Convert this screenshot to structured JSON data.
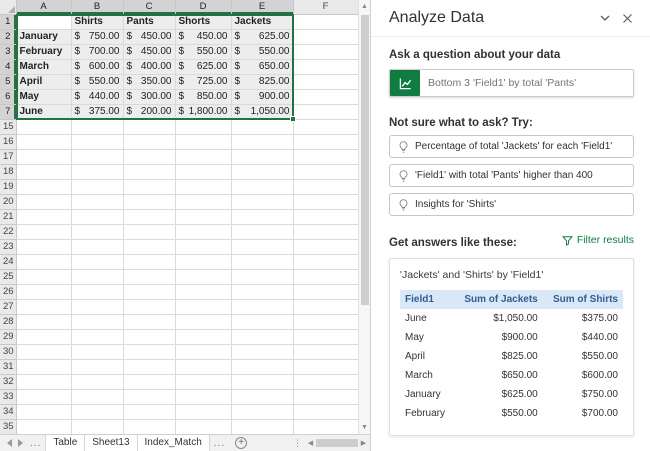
{
  "colors": {
    "excel_green": "#217346",
    "query_icon_green": "#107C41",
    "filter_link_green": "#0E7C41",
    "header_bg": "#E9E9E9",
    "header_selected_bg": "#D3D3D3",
    "selection_fill": "#EDEDED",
    "table_header_bg": "#D9E7F6",
    "table_header_text": "#2E5E94"
  },
  "spreadsheet": {
    "currency": "$",
    "columns": [
      "A",
      "B",
      "C",
      "D",
      "E",
      "F"
    ],
    "selected_columns": [
      "A",
      "B",
      "C",
      "D",
      "E"
    ],
    "selected_rows": [
      1,
      2,
      3,
      4,
      5,
      6,
      7
    ],
    "active_cell": "A1",
    "rows": [
      {
        "num": 1,
        "cells": [
          "",
          "Shirts",
          "Pants",
          "Shorts",
          "Jackets"
        ],
        "bold": true
      },
      {
        "num": 2,
        "cells": [
          "January",
          "750.00",
          "450.00",
          "450.00",
          "625.00"
        ],
        "currency": true
      },
      {
        "num": 3,
        "cells": [
          "February",
          "700.00",
          "450.00",
          "550.00",
          "550.00"
        ],
        "currency": true
      },
      {
        "num": 4,
        "cells": [
          "March",
          "600.00",
          "400.00",
          "625.00",
          "650.00"
        ],
        "currency": true
      },
      {
        "num": 5,
        "cells": [
          "April",
          "550.00",
          "350.00",
          "725.00",
          "825.00"
        ],
        "currency": true
      },
      {
        "num": 6,
        "cells": [
          "May",
          "440.00",
          "300.00",
          "850.00",
          "900.00"
        ],
        "currency": true
      },
      {
        "num": 7,
        "cells": [
          "June",
          "375.00",
          "200.00",
          "1,800.00",
          "1,050.00"
        ],
        "currency": true
      }
    ],
    "empty_row_numbers": [
      15,
      16,
      17,
      18,
      19,
      20,
      21,
      22,
      23,
      24,
      25,
      26,
      27,
      28,
      29,
      30,
      31,
      32,
      33,
      34,
      35
    ]
  },
  "sheet_tabs": {
    "tabs": [
      "Table",
      "Sheet13",
      "Index_Match"
    ],
    "overflow_indicator": "...",
    "new_sheet_label": "+"
  },
  "pane": {
    "title": "Analyze Data",
    "ask_heading": "Ask a question about your data",
    "query_text": "Bottom 3 'Field1' by total 'Pants'",
    "try_heading": "Not sure what to ask? Try:",
    "suggestions": [
      "Percentage of total 'Jackets' for each 'Field1'",
      "'Field1' with total 'Pants' higher than 400",
      "Insights for 'Shirts'"
    ],
    "answers_heading": "Get answers like these:",
    "filter_label": "Filter results",
    "card": {
      "title": "'Jackets' and 'Shirts' by 'Field1'",
      "table": {
        "headers": [
          "Field1",
          "Sum of Jackets",
          "Sum of Shirts"
        ],
        "rows": [
          [
            "June",
            "$1,050.00",
            "$375.00"
          ],
          [
            "May",
            "$900.00",
            "$440.00"
          ],
          [
            "April",
            "$825.00",
            "$550.00"
          ],
          [
            "March",
            "$650.00",
            "$600.00"
          ],
          [
            "January",
            "$625.00",
            "$750.00"
          ],
          [
            "February",
            "$550.00",
            "$700.00"
          ]
        ]
      }
    }
  }
}
